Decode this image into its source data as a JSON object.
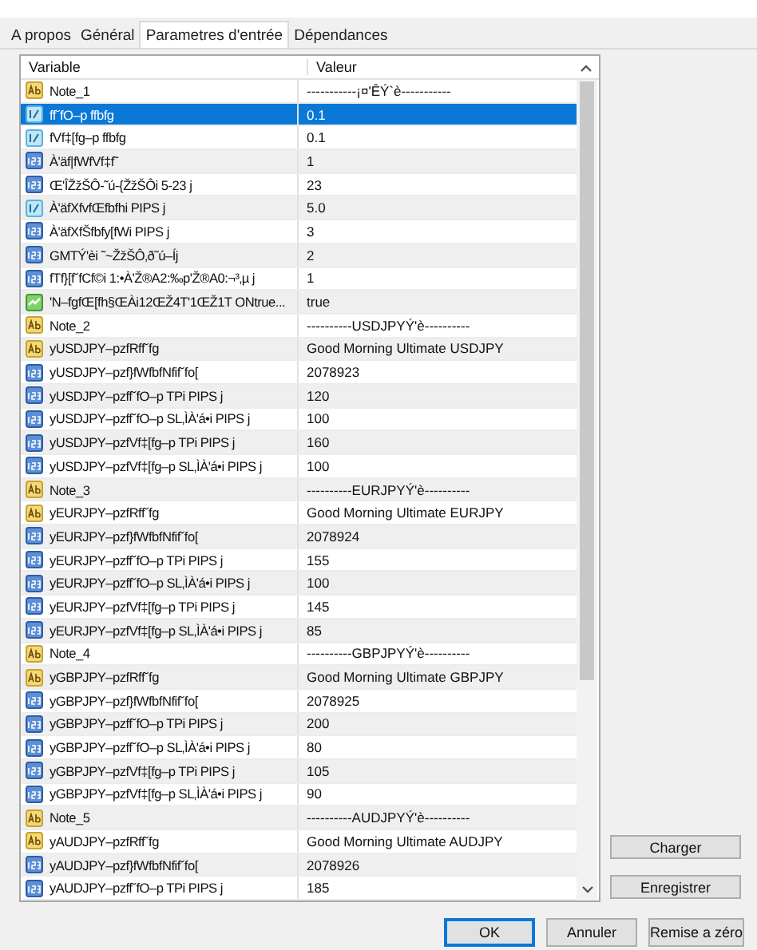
{
  "tabs": [
    {
      "label": "A propos",
      "selected": false
    },
    {
      "label": "Général",
      "selected": false
    },
    {
      "label": "Parametres d'entrée",
      "selected": true
    },
    {
      "label": "Dépendances",
      "selected": false
    }
  ],
  "table": {
    "columns": [
      "Variable",
      "Valeur"
    ],
    "rows": [
      {
        "kind": "string",
        "variable": "Note_1",
        "value": "-----------¡¤'ÊÝ`è-----------",
        "selected": false
      },
      {
        "kind": "double",
        "variable": "ff˘fO–p ffbfg",
        "value": "0.1",
        "selected": true
      },
      {
        "kind": "double",
        "variable": "fVf‡[fg–p ffbfg",
        "value": "0.1",
        "selected": false
      },
      {
        "kind": "int",
        "variable": "À'äf|fWfVf‡f˜",
        "value": "1",
        "selected": false
      },
      {
        "kind": "int",
        "variable": "Œ'ÎŽžŠÔ-˜ú-{ŽžŠÔi 5-23 j",
        "value": "23",
        "selected": false
      },
      {
        "kind": "double",
        "variable": "À'äfXfvfŒfbfhi PIPS j",
        "value": "5.0",
        "selected": false
      },
      {
        "kind": "int",
        "variable": "À'äfXfŠfbfy[fWi PIPS j",
        "value": "3",
        "selected": false
      },
      {
        "kind": "int",
        "variable": "GMTÝ'èi ˜~ŽžŠÔ‚ð˜ú–Íj",
        "value": "2",
        "selected": false
      },
      {
        "kind": "int",
        "variable": "fTf}[f˘fCf©i 1:•À'Ž®A2:‰p'Ž®A0:¬³‚µ j",
        "value": "1",
        "selected": false
      },
      {
        "kind": "bool",
        "variable": "'N–fgfŒ[fh§ŒÀi12ŒŽ4T'1ŒŽ1T ONtrue...",
        "value": "true",
        "selected": false
      },
      {
        "kind": "string",
        "variable": "Note_2",
        "value": "----------USDJPYÝ'è----------",
        "selected": false
      },
      {
        "kind": "string",
        "variable": "yUSDJPY–pzfRff˘fg",
        "value": "Good Morning Ultimate USDJPY",
        "selected": false
      },
      {
        "kind": "int",
        "variable": "yUSDJPY–pzf}fWfbfNfif˘fo[",
        "value": "2078923",
        "selected": false
      },
      {
        "kind": "int",
        "variable": "yUSDJPY–pzff˘fO–p TPi PIPS j",
        "value": "120",
        "selected": false
      },
      {
        "kind": "int",
        "variable": "yUSDJPY–pzff˘fO–p SL‚ÌÀ'á•i PIPS j",
        "value": "100",
        "selected": false
      },
      {
        "kind": "int",
        "variable": "yUSDJPY–pzfVf‡[fg–p TPi PIPS j",
        "value": "160",
        "selected": false
      },
      {
        "kind": "int",
        "variable": "yUSDJPY–pzfVf‡[fg–p SL‚ÌÀ'á•i PIPS j",
        "value": "100",
        "selected": false
      },
      {
        "kind": "string",
        "variable": "Note_3",
        "value": "----------EURJPYÝ'è----------",
        "selected": false
      },
      {
        "kind": "string",
        "variable": "yEURJPY–pzfRff˘fg",
        "value": "Good Morning Ultimate EURJPY",
        "selected": false
      },
      {
        "kind": "int",
        "variable": "yEURJPY–pzf}fWfbfNfif˘fo[",
        "value": "2078924",
        "selected": false
      },
      {
        "kind": "int",
        "variable": "yEURJPY–pzff˘fO–p TPi PIPS j",
        "value": "155",
        "selected": false
      },
      {
        "kind": "int",
        "variable": "yEURJPY–pzff˘fO–p SL‚ÌÀ'á•i PIPS j",
        "value": "100",
        "selected": false
      },
      {
        "kind": "int",
        "variable": "yEURJPY–pzfVf‡[fg–p TPi PIPS j",
        "value": "145",
        "selected": false
      },
      {
        "kind": "int",
        "variable": "yEURJPY–pzfVf‡[fg–p SL‚ÌÀ'á•i PIPS j",
        "value": "85",
        "selected": false
      },
      {
        "kind": "string",
        "variable": "Note_4",
        "value": "----------GBPJPYÝ'è----------",
        "selected": false
      },
      {
        "kind": "string",
        "variable": "yGBPJPY–pzfRff˘fg",
        "value": "Good Morning Ultimate GBPJPY",
        "selected": false
      },
      {
        "kind": "int",
        "variable": "yGBPJPY–pzf}fWfbfNfif˘fo[",
        "value": "2078925",
        "selected": false
      },
      {
        "kind": "int",
        "variable": "yGBPJPY–pzff˘fO–p TPi PIPS j",
        "value": "200",
        "selected": false
      },
      {
        "kind": "int",
        "variable": "yGBPJPY–pzff˘fO–p SL‚ÌÀ'á•i PIPS j",
        "value": "80",
        "selected": false
      },
      {
        "kind": "int",
        "variable": "yGBPJPY–pzfVf‡[fg–p TPi PIPS j",
        "value": "105",
        "selected": false
      },
      {
        "kind": "int",
        "variable": "yGBPJPY–pzfVf‡[fg–p SL‚ÌÀ'á•i PIPS j",
        "value": "90",
        "selected": false
      },
      {
        "kind": "string",
        "variable": "Note_5",
        "value": "----------AUDJPYÝ'è----------",
        "selected": false
      },
      {
        "kind": "string",
        "variable": "yAUDJPY–pzfRff˘fg",
        "value": "Good Morning Ultimate AUDJPY",
        "selected": false
      },
      {
        "kind": "int",
        "variable": "yAUDJPY–pzf}fWfbfNfif˘fo[",
        "value": "2078926",
        "selected": false
      },
      {
        "kind": "int",
        "variable": "yAUDJPY–pzff˘fO–p TPi PIPS j",
        "value": "185",
        "selected": false
      }
    ]
  },
  "side_buttons": [
    "Charger",
    "Enregistrer"
  ],
  "buttons": [
    {
      "label": "OK",
      "default": true
    },
    {
      "label": "Annuler",
      "default": false
    },
    {
      "label": "Remise a zéro",
      "default": false
    }
  ]
}
